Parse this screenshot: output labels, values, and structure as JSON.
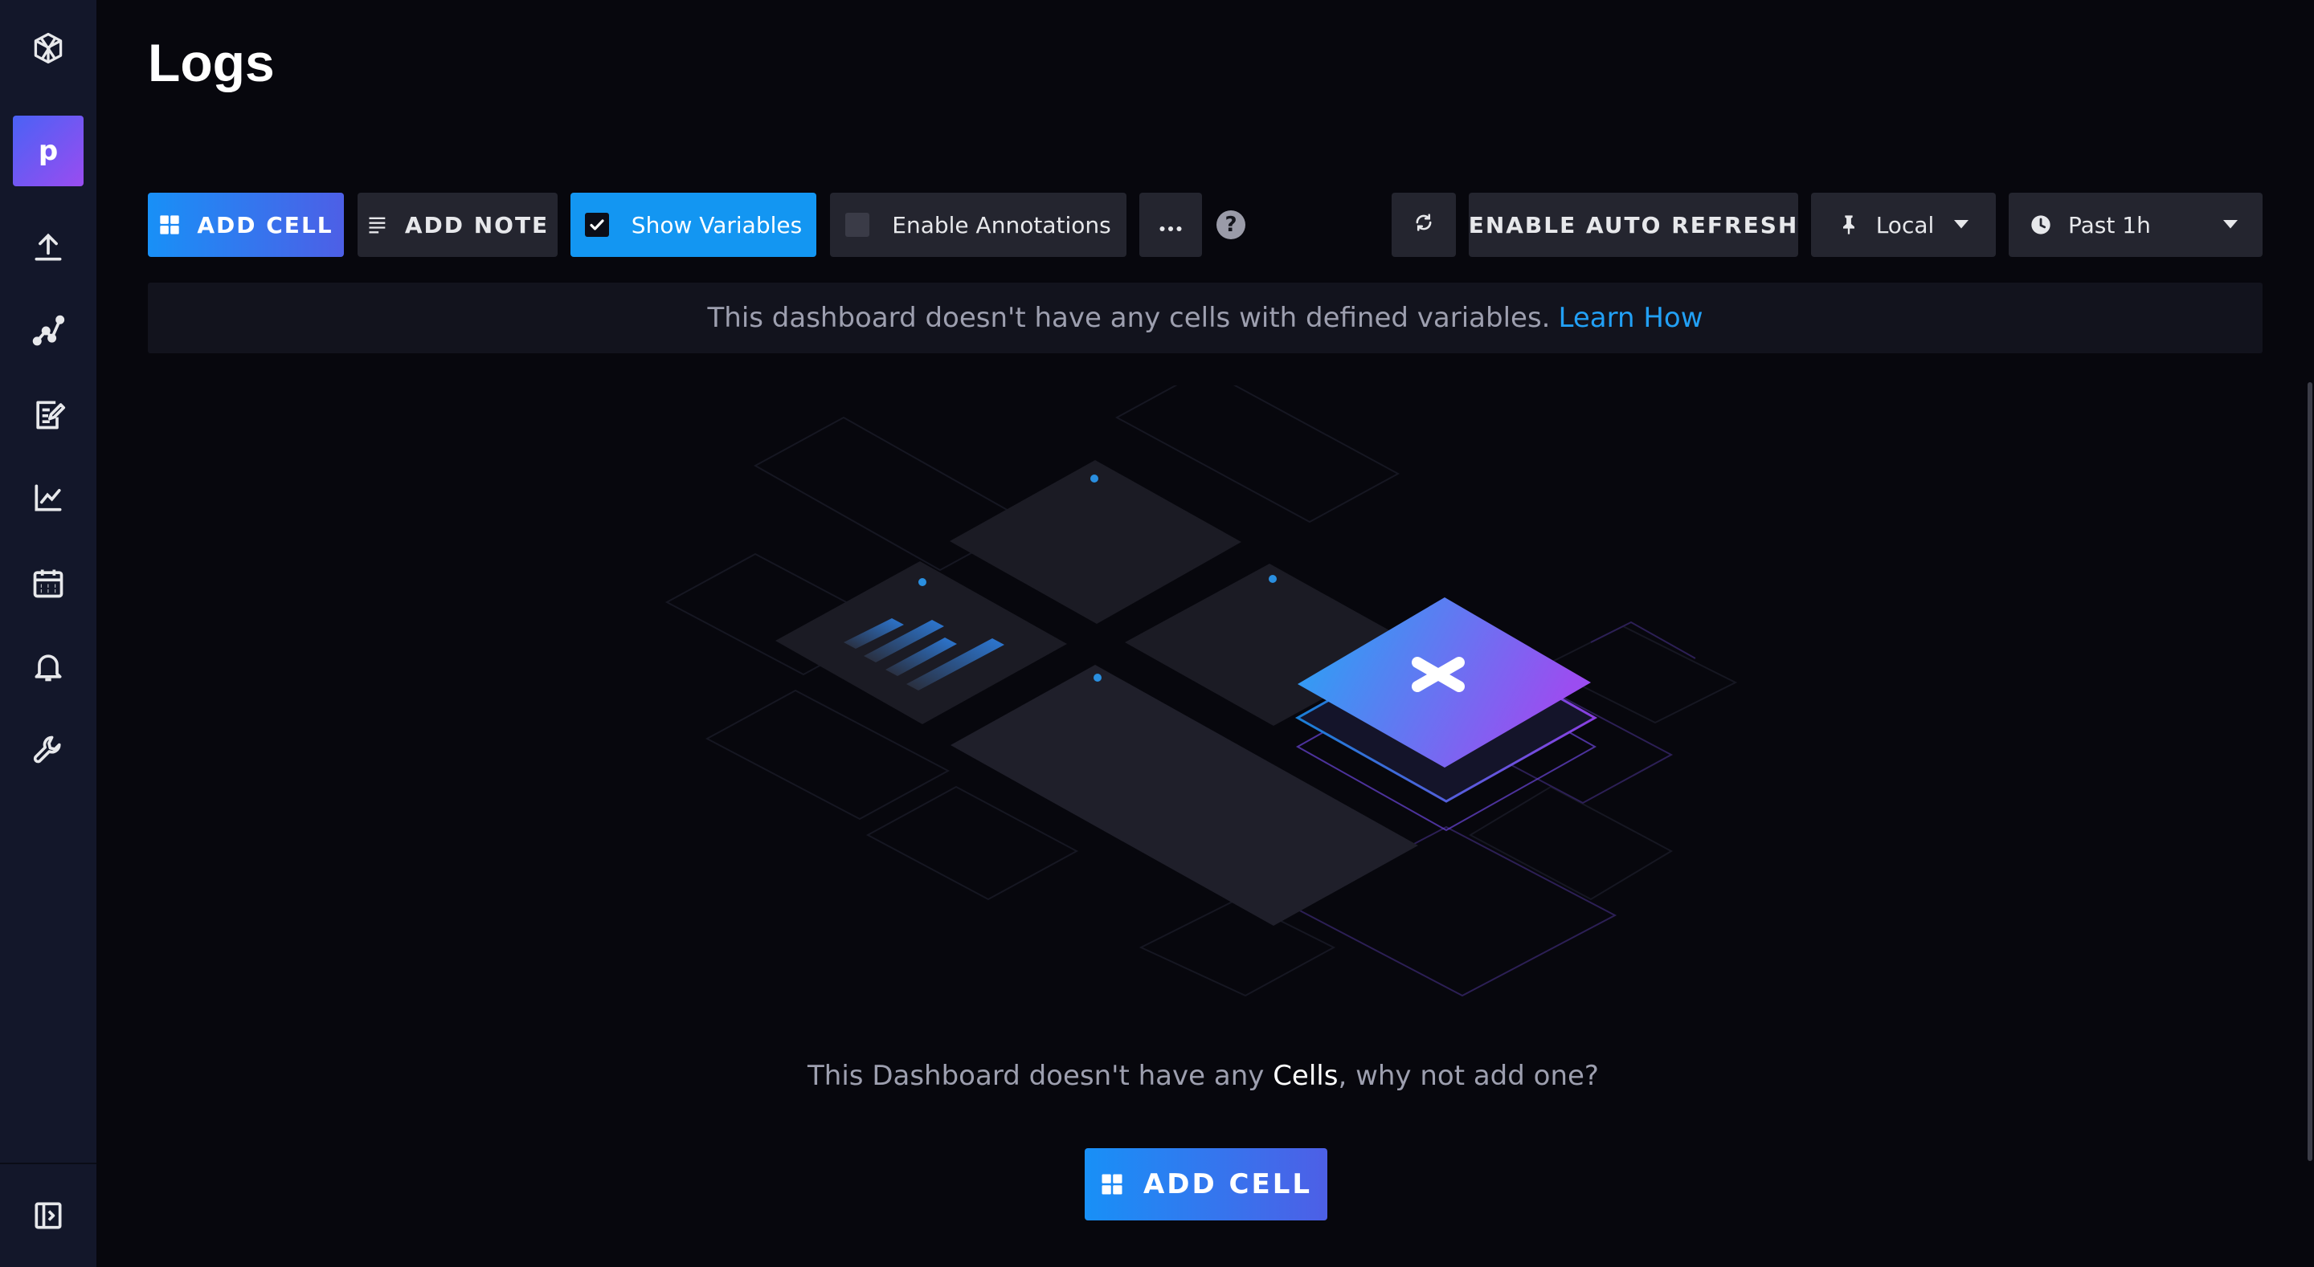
{
  "page": {
    "title": "Logs"
  },
  "sidebar": {
    "avatar_letter": "p",
    "items": [
      {
        "icon": "logo-cube-icon"
      },
      {
        "icon": "upload-icon"
      },
      {
        "icon": "graph-node-icon"
      },
      {
        "icon": "notebook-edit-icon"
      },
      {
        "icon": "line-chart-icon"
      },
      {
        "icon": "calendar-icon"
      },
      {
        "icon": "bell-icon"
      },
      {
        "icon": "wrench-icon"
      },
      {
        "icon": "collapse-sidebar-icon"
      }
    ]
  },
  "toolbar": {
    "add_cell": "ADD CELL",
    "add_note": "ADD NOTE",
    "show_variables": "Show Variables",
    "show_variables_checked": true,
    "enable_annotations": "Enable Annotations",
    "enable_annotations_checked": false,
    "more": "...",
    "help": "?",
    "auto_refresh": "ENABLE AUTO REFRESH",
    "timezone": "Local",
    "time_range": "Past 1h"
  },
  "banner": {
    "text": "This dashboard doesn't have any cells with defined variables.",
    "link": "Learn How"
  },
  "empty_state": {
    "prefix": "This Dashboard doesn't have any ",
    "highlight": "Cells",
    "suffix": ", why not add one?",
    "button": "ADD CELL"
  },
  "colors": {
    "accent_blue": "#1396f2",
    "gradient_start": "#1890f7",
    "gradient_end": "#4d5fe6",
    "link": "#22a0f5"
  }
}
